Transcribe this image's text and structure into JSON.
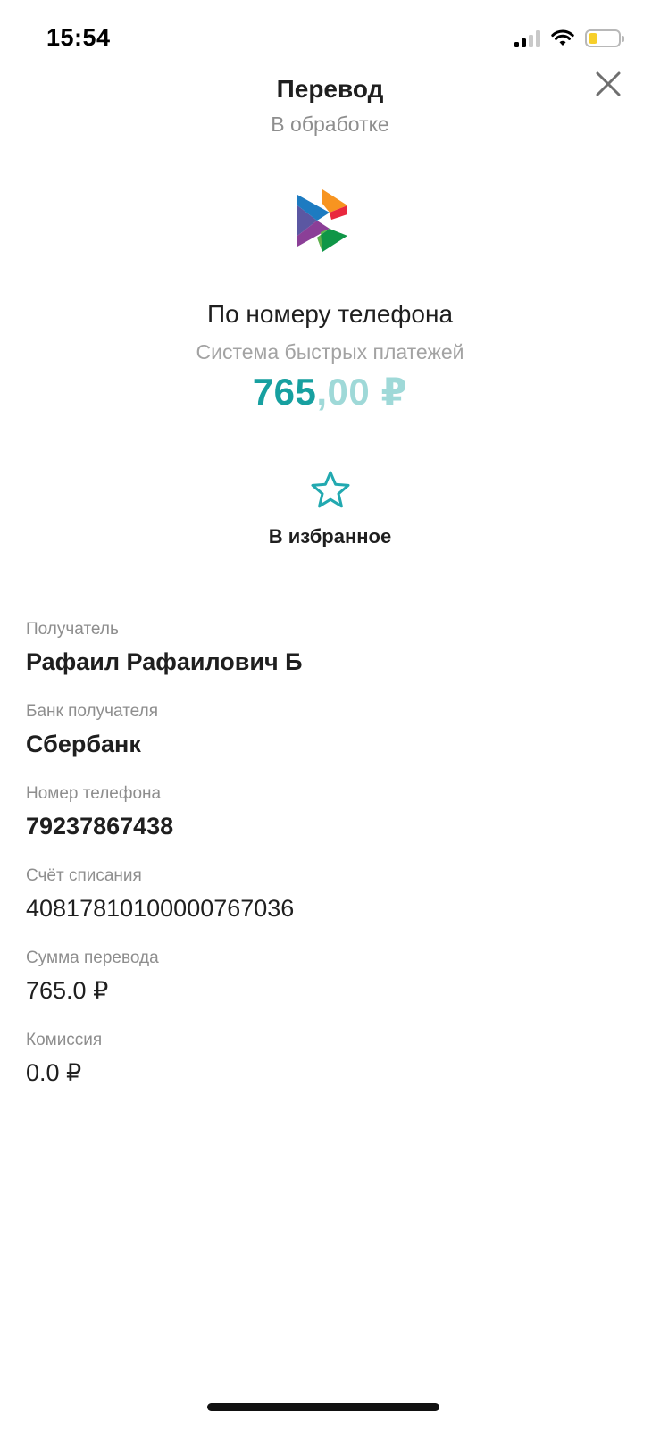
{
  "status_bar": {
    "time": "15:54",
    "signal_bars_active": 2,
    "signal_bars_total": 4,
    "battery_level": 0.3,
    "battery_color": "#f7cf2a"
  },
  "header": {
    "title": "Перевод",
    "status": "В обработке",
    "close_icon": "close-icon"
  },
  "logo": {
    "icon": "sbp-logo-icon"
  },
  "transfer": {
    "type": "По номеру телефона",
    "system": "Система быстрых платежей",
    "amount_int": "765",
    "amount_frac": ",00 ₽",
    "accent_color": "#17a0a0"
  },
  "favorite": {
    "icon": "star-icon",
    "label": "В избранное"
  },
  "details": [
    {
      "label": "Получатель",
      "value": "Рафаил Рафаилович Б"
    },
    {
      "label": "Банк получателя",
      "value": "Сбербанк"
    },
    {
      "label": "Номер телефона",
      "value": "79237867438"
    },
    {
      "label": "Счёт списания",
      "value": "40817810100000767036"
    },
    {
      "label": "Сумма перевода",
      "value": "765.0 ₽"
    },
    {
      "label": "Комиссия",
      "value": "0.0 ₽"
    }
  ]
}
